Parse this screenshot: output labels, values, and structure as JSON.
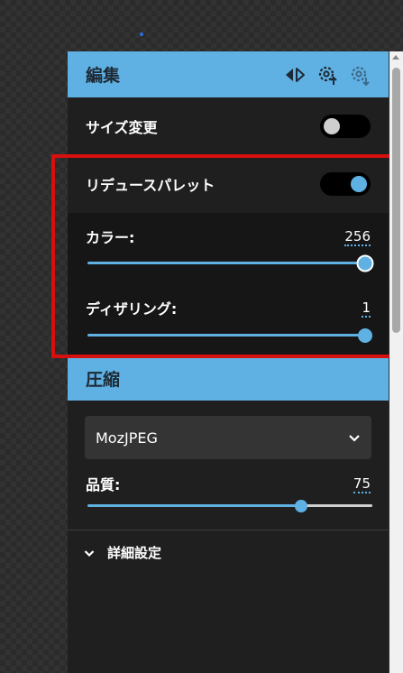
{
  "edit_section": {
    "title": "編集",
    "icons": [
      "split-view-icon",
      "settings-upload-icon",
      "settings-download-icon"
    ]
  },
  "resize": {
    "label": "サイズ変更",
    "enabled": false
  },
  "reduce_palette": {
    "label": "リデュースパレット",
    "enabled": true,
    "colors": {
      "label": "カラー:",
      "value": "256",
      "fraction": 1.0
    },
    "dithering": {
      "label": "ディザリング:",
      "value": "1",
      "fraction": 1.0
    }
  },
  "compress_section": {
    "title": "圧縮",
    "codec": {
      "selected": "MozJPEG"
    },
    "quality": {
      "label": "品質:",
      "value": "75",
      "fraction": 0.75
    },
    "advanced_label": "詳細設定"
  },
  "colors": {
    "accent": "#5fb1e4",
    "highlight": "#d60f0f",
    "panel": "#1f1f1f"
  }
}
